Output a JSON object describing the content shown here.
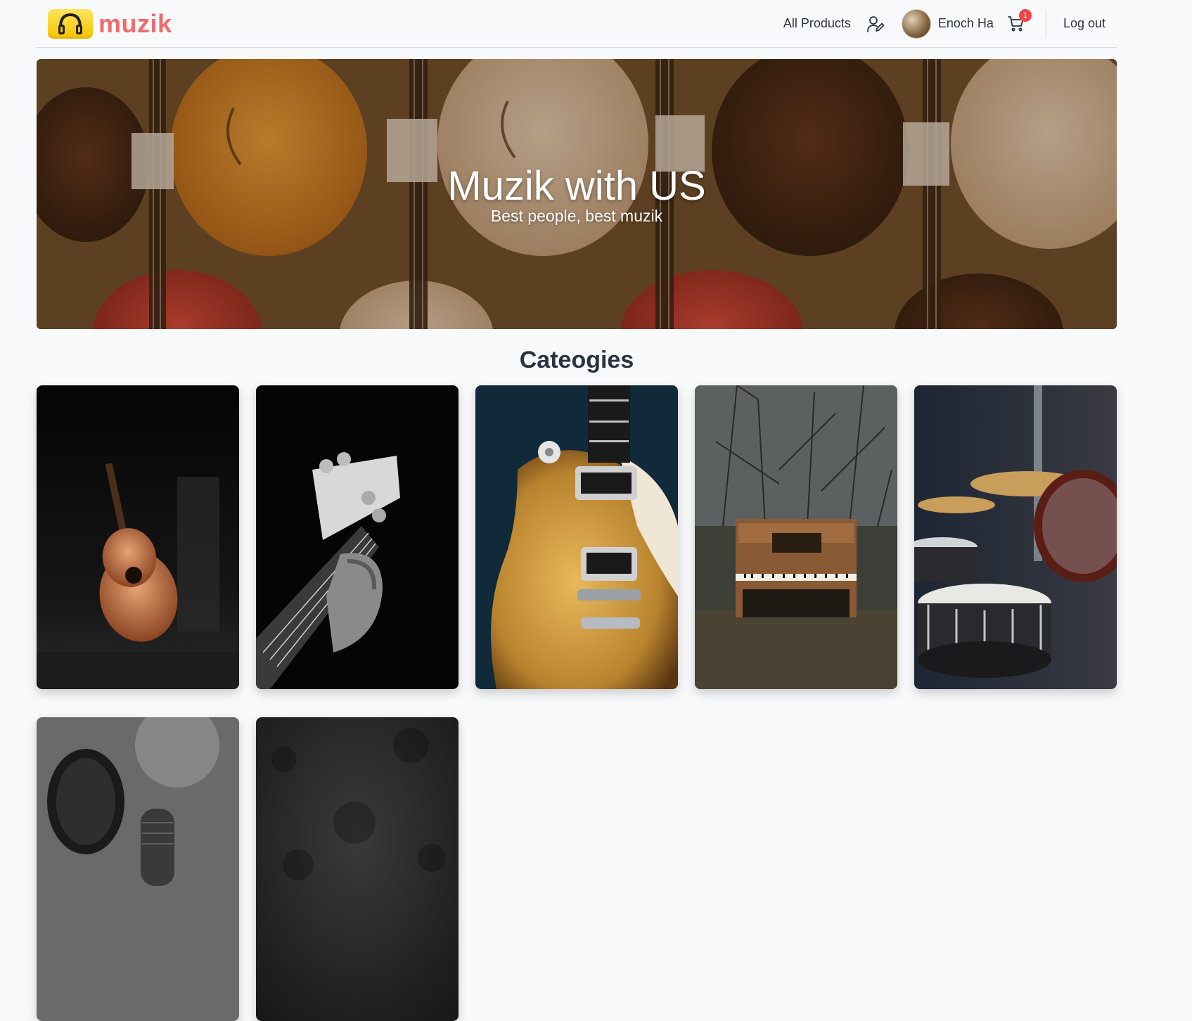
{
  "brand": {
    "name": "muzik",
    "logo_icon": "headphones-icon",
    "logo_color": "#f5c400",
    "name_color": "#f06b6b"
  },
  "nav": {
    "all_products": "All Products",
    "account_icon": "user-edit-icon",
    "user_name": "Enoch Ha",
    "cart_icon": "shopping-cart-icon",
    "cart_count": "1",
    "logout": "Log out"
  },
  "hero": {
    "title": "Muzik with US",
    "subtitle": "Best people, best muzik"
  },
  "categories": {
    "title": "Cateogies",
    "items": [
      {
        "image": "acoustic-guitar"
      },
      {
        "image": "bass-guitar"
      },
      {
        "image": "electric-guitar"
      },
      {
        "image": "piano"
      },
      {
        "image": "drums"
      },
      {
        "image": "microphone"
      },
      {
        "image": "dark-texture"
      }
    ]
  }
}
